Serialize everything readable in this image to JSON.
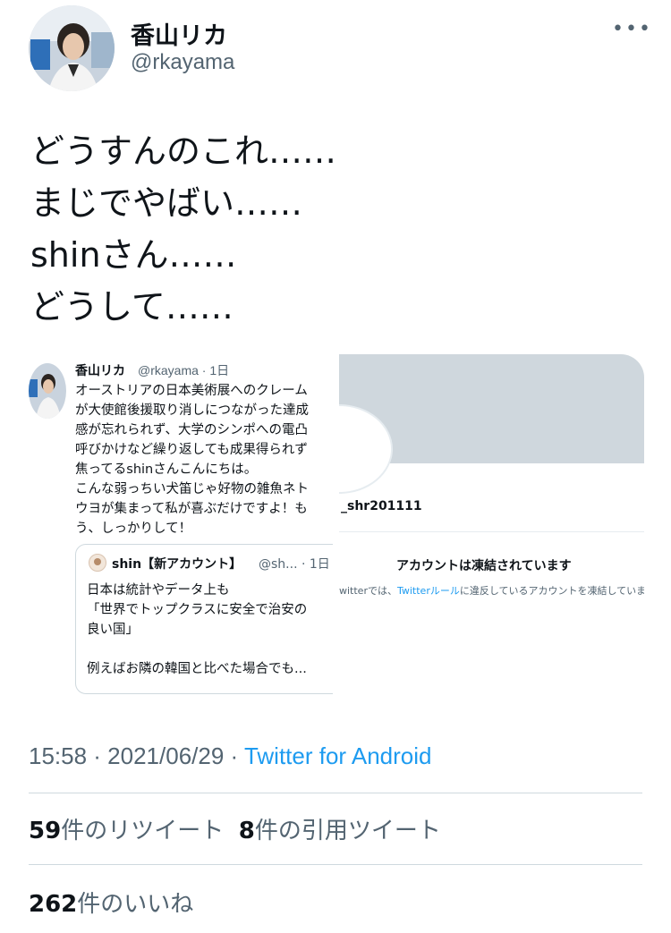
{
  "author": {
    "display_name": "香山リカ",
    "handle": "@rkayama"
  },
  "menu_icon": "more-horizontal-icon",
  "tweet_lines": [
    "どうすんのこれ……",
    "まじでやばい……",
    "shinさん……",
    "どうして……"
  ],
  "embedded_left": {
    "name": "香山リカ",
    "meta": "@rkayama · 1日",
    "lines": [
      "オーストリアの日本美術展へのクレーム",
      "が大使館後援取り消しにつながった達成",
      "感が忘れられず、大学のシンポへの電凸",
      "呼びかけなど繰り返しても成果得られず",
      "焦ってるshinさんこんにちは。",
      "こんな弱っちい犬笛じゃ好物の雑魚ネト",
      "ウヨが集まって私が喜ぶだけですよ！も",
      "う、しっかりして！"
    ],
    "quote": {
      "name": "shin【新アカウント】",
      "handle": "@sh... · 1日",
      "lines": [
        "日本は統計やデータ上も",
        "「世界でトップクラスに安全で治安の",
        "良い国」",
        "",
        "例えばお隣の韓国と比べた場合でも..."
      ]
    }
  },
  "embedded_right": {
    "handle": "_shr201111",
    "suspended_title": "アカウントは凍結されています",
    "suspended_desc_prefix": "witterでは、",
    "suspended_desc_link": "Twitterルール",
    "suspended_desc_suffix": "に違反しているアカウントを凍結していま"
  },
  "footer": {
    "time": "15:58 · 2021/06/29 · ",
    "source": "Twitter for Android",
    "retweets_count": "59",
    "retweets_label": "件のリツイート",
    "quotes_count": "8",
    "quotes_label": "件の引用ツイート",
    "likes_count": "262",
    "likes_label": "件のいいね"
  },
  "colors": {
    "text": "#0f1419",
    "secondary": "#536471",
    "link": "#1d9bf0",
    "divider": "#cfd9de",
    "banner": "#cfd7dd"
  }
}
